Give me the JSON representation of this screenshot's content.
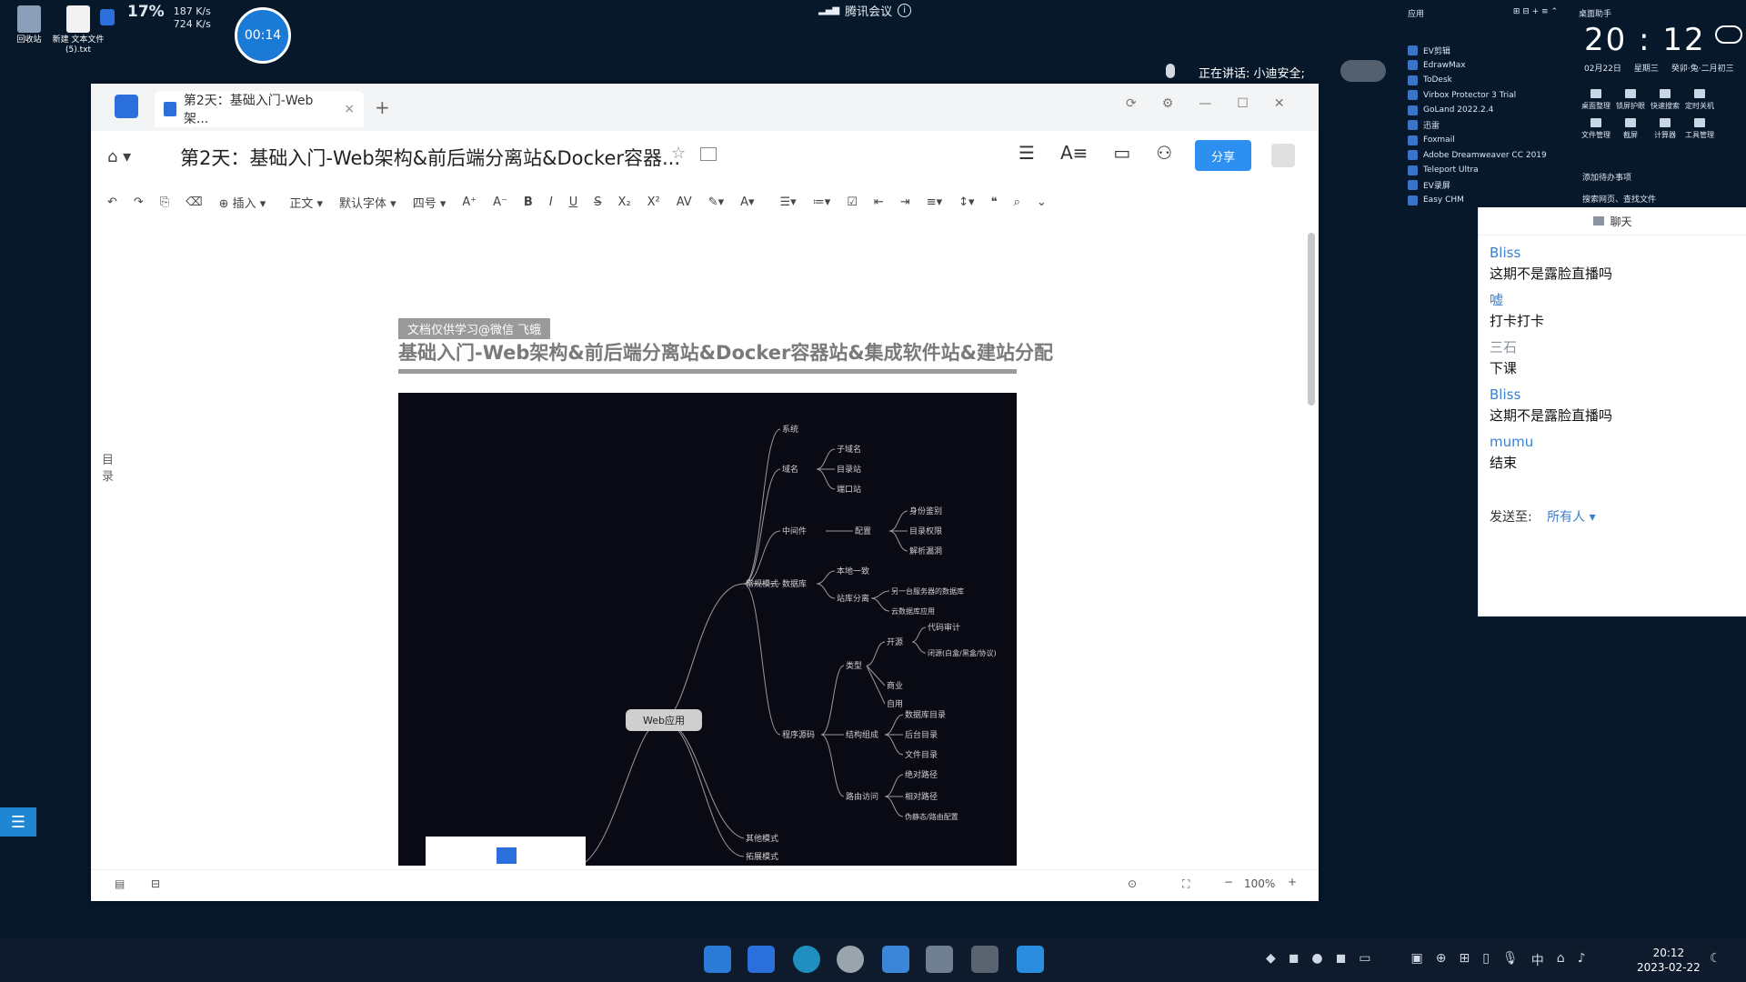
{
  "desktop": {
    "icons": [
      {
        "label": "回收站"
      },
      {
        "label": "新建 文本文件 (5).txt"
      }
    ],
    "cpu": "17%",
    "net_up": "187 K/s",
    "net_down": "724 K/s",
    "timer": "00:14"
  },
  "meeting": {
    "title": "腾讯会议",
    "speaking": "正在讲话: 小迪安全;"
  },
  "apps_panel": {
    "header": "应用",
    "items": [
      "EV剪辑",
      "EdrawMax",
      "ToDesk",
      "Virbox Protector 3 Trial",
      "GoLand 2022.2.4",
      "迅雷",
      "Foxmail",
      "Adobe Dreamweaver CC 2019",
      "Teleport Ultra",
      "EV录屏",
      "Easy CHM"
    ]
  },
  "clock": {
    "title": "桌面助手",
    "time": "20 : 12",
    "date": "02月22日",
    "weekday": "星期三",
    "lunar": "癸卯·兔·二月初三",
    "buttons": [
      "桌面整理",
      "锁屏护眼",
      "快速搜索",
      "定时关机",
      "文件管理",
      "截屏",
      "计算器",
      "工具管理"
    ],
    "todo": "添加待办事项",
    "search": "搜索网页、查找文件"
  },
  "chat": {
    "header": "聊天",
    "messages": [
      {
        "name": "Bliss",
        "text": "这期不是露脸直播吗",
        "gray": false
      },
      {
        "name": "嘘",
        "text": "打卡打卡",
        "gray": false
      },
      {
        "name": "三石",
        "text": "下课",
        "gray": true
      },
      {
        "name": "Bliss",
        "text": "这期不是露脸直播吗",
        "gray": false
      },
      {
        "name": "mumu",
        "text": "结束",
        "gray": false
      }
    ],
    "send_label": "发送至:",
    "send_target": "所有人"
  },
  "window": {
    "tab_title": "第2天：基础入门-Web架...",
    "doc_title": "第2天：基础入门-Web架构&前后端分离站&Docker容器...",
    "share": "分享",
    "toolbar": [
      "插入",
      "正文",
      "默认字体",
      "四号"
    ],
    "toc": "目录",
    "doc_tag": "文档仅供学习@微信 飞蛾",
    "doc_heading": "基础入门-Web架构&前后端分离站&Docker容器站&集成软件站&建站分配",
    "zoom": "100%"
  },
  "mindmap": {
    "root": "Web应用",
    "nodes": [
      "系统",
      "域名",
      "子域名",
      "目录站",
      "端口站",
      "中间件",
      "配置",
      "身份鉴别",
      "目录权限",
      "解析漏洞",
      "常规模式",
      "数据库",
      "本地一致",
      "站库分离",
      "另一台服务器的数据库",
      "云数据库应用",
      "开源",
      "代码审计",
      "闭源(白盒/黑盒/协议)",
      "类型",
      "商业",
      "自用",
      "程序源码",
      "结构组成",
      "数据库目录",
      "后台目录",
      "文件目录",
      "路由访问",
      "绝对路径",
      "相对路径",
      "伪静态/路由配置",
      "其他模式",
      "拓展模式"
    ]
  },
  "taskbar": {
    "time": "20:12",
    "date": "2023-02-22",
    "ime": "中"
  }
}
